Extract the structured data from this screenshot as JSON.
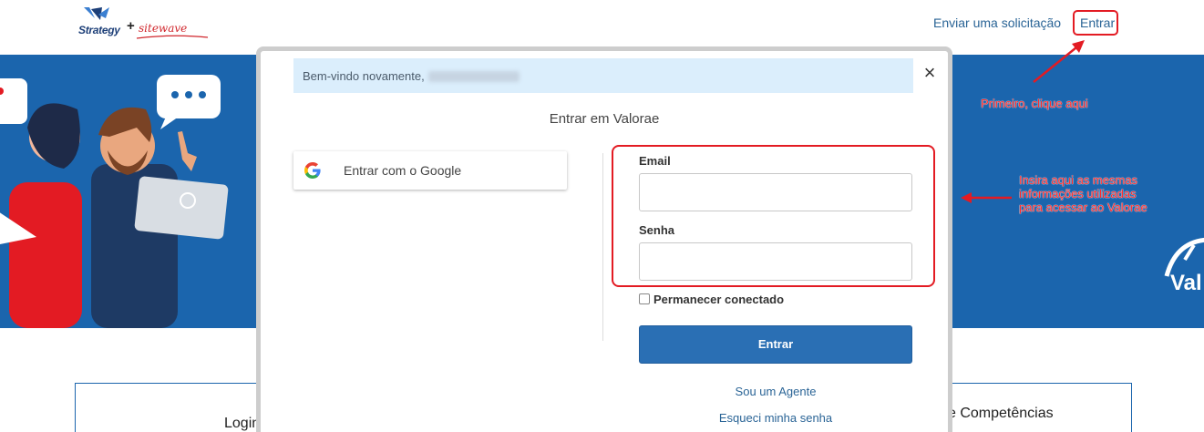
{
  "header": {
    "logo_strategy": "Strategy",
    "logo_plus": "+",
    "logo_sitewave": "sitewave",
    "link_solicitacao": "Enviar uma solicitação",
    "link_entrar": "Entrar"
  },
  "annotations": {
    "first_click": "Primeiro, clique aqui",
    "insert_info": "Insira aqui as mesmas informações utilizadas para acessar ao Valorae"
  },
  "hero": {
    "brand_partial": "Val"
  },
  "lower": {
    "left_text": "Login",
    "right_text": "e Competências"
  },
  "modal": {
    "welcome_text": "Bem-vindo novamente,",
    "title": "Entrar em Valorae",
    "google_label": "Entrar com o Google",
    "email_label": "Email",
    "email_value": "",
    "password_label": "Senha",
    "password_value": "",
    "remember_label": "Permanecer conectado",
    "remember_checked": false,
    "submit_label": "Entrar",
    "agent_link": "Sou um Agente",
    "forgot_link": "Esqueci minha senha",
    "close_symbol": "×"
  },
  "colors": {
    "hero_blue": "#1b65ad",
    "annotation_red": "#e31b23",
    "submit_blue": "#2a6fb4",
    "welcome_bg": "#dbeefc"
  },
  "icons": [
    "google-icon",
    "close-icon",
    "arrow-icon",
    "speech-bubble-icon"
  ]
}
